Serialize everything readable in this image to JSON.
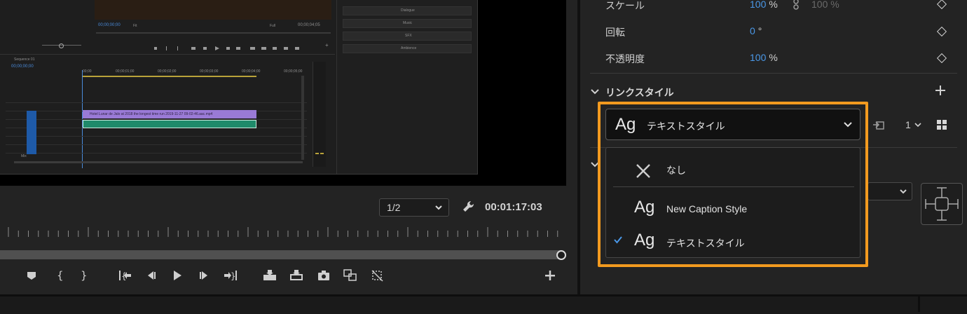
{
  "monitor": {
    "zoom": "1/2",
    "timecode": "00:01:17:03",
    "nested": {
      "program_timecode": "00;00;00;00",
      "fit": "Fit",
      "full": "Full",
      "duration": "00;00;04;05",
      "sequence_name": "Sequence 01",
      "sequence_timecode": "00;00;00;00",
      "ruler_ticks": [
        "00;00",
        "00;00;01;00",
        "00;00;02;00",
        "00;00;03;00",
        "00;00;04;00",
        "00;00;05;00"
      ],
      "video_clip_label": "Hotel Lunar de Jalo at 2018 the longest time run 2019-11-27 09-02-46.aac.mp4",
      "essential_sound_buttons": [
        "Dialogue",
        "Music",
        "SFX",
        "Ambience"
      ],
      "track_mix": "Mix"
    }
  },
  "properties": {
    "rows": [
      {
        "label": "スケール",
        "value": "100",
        "unit": "%",
        "linked_value": "100 %"
      },
      {
        "label": "回転",
        "value": "0",
        "unit": "°"
      },
      {
        "label": "不透明度",
        "value": "100",
        "unit": "%"
      }
    ],
    "section_title": "リンクスタイル",
    "dropdown": {
      "icon_text": "Ag",
      "label": "テキストスタイル"
    },
    "count": "1",
    "menu": {
      "items": [
        {
          "label": "なし",
          "icon_text": ""
        },
        {
          "label": "New Caption Style",
          "icon_text": "Ag"
        },
        {
          "label": "テキストスタイル",
          "icon_text": "Ag",
          "checked": true
        }
      ]
    }
  },
  "colors": {
    "highlight": "#f29a1f",
    "accent": "#4a98e8"
  }
}
